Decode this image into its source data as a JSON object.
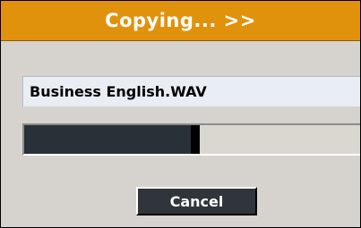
{
  "dialog": {
    "title": "Copying... >>",
    "filename": "Business English.WAV",
    "progress": 0.51,
    "cancel_label": "Cancel"
  },
  "colors": {
    "title_bar": "#e1920d",
    "body": "#d6d3ce",
    "progress_fill": "#283038",
    "button": "#2f353a"
  }
}
